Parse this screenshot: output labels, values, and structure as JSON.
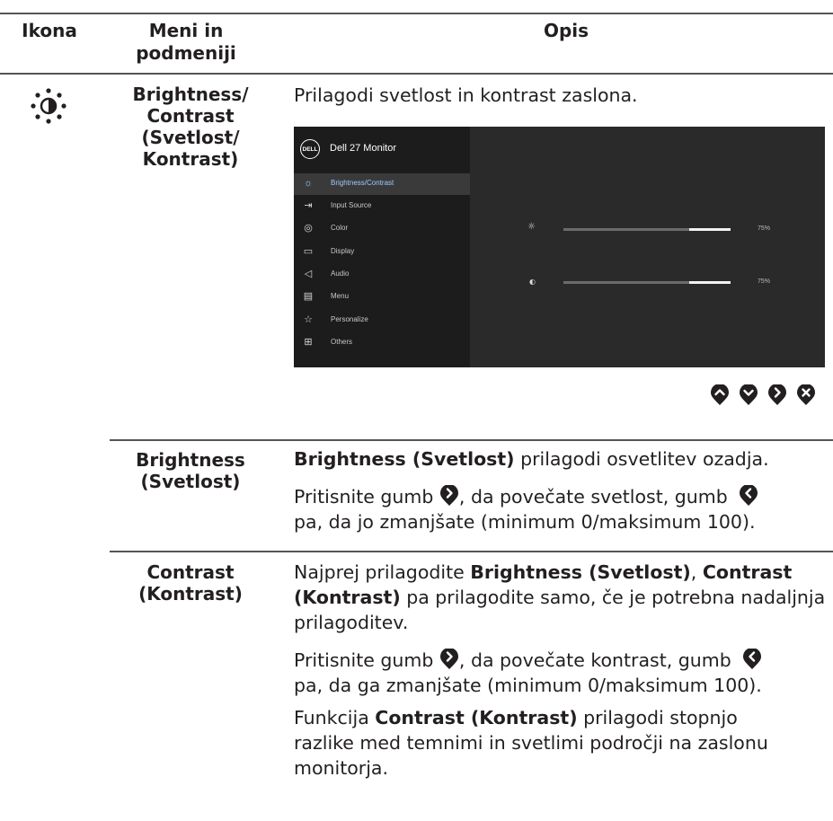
{
  "header": {
    "col_icon": "Ikona",
    "col_menu": "Meni in podmeniji",
    "col_desc": "Opis"
  },
  "row_main": {
    "icon": "brightness-icon",
    "menu_label": "Brightness/ Contrast (Svetlost/ Kontrast)",
    "menu_lines": [
      "Brightness/",
      "Contrast",
      "(Svetlost/",
      "Kontrast)"
    ],
    "description": "Prilagodi svetlost in kontrast zaslona."
  },
  "osd": {
    "title": "Dell 27 Monitor",
    "logo": "DELL",
    "menu_items": [
      {
        "label": "Brightness/Contrast",
        "icon": "sun-icon",
        "active": true
      },
      {
        "label": "Input Source",
        "icon": "input-icon",
        "active": false
      },
      {
        "label": "Color",
        "icon": "color-icon",
        "active": false
      },
      {
        "label": "Display",
        "icon": "display-icon",
        "active": false
      },
      {
        "label": "Audio",
        "icon": "audio-icon",
        "active": false
      },
      {
        "label": "Menu",
        "icon": "menu-icon",
        "active": false
      },
      {
        "label": "Personalize",
        "icon": "star-icon",
        "active": false
      },
      {
        "label": "Others",
        "icon": "others-icon",
        "active": false
      }
    ],
    "brightness": {
      "value": 75,
      "label": "75%"
    },
    "contrast": {
      "value": 75,
      "label": "75%"
    }
  },
  "nav_buttons": [
    "up-button",
    "down-button",
    "right-button",
    "close-button"
  ],
  "row_brightness": {
    "menu_lines": [
      "Brightness",
      "(Svetlost)"
    ],
    "p1_bold": "Brightness (Svetlost)",
    "p1_rest": " prilagodi osvetlitev ozadja.",
    "p2_a": "Pritisnite gumb ",
    "p2_b": ", da povečate svetlost, gumb ",
    "p2_c": "pa, da jo zmanjšate (minimum 0/maksimum 100)."
  },
  "row_contrast": {
    "menu_lines": [
      "Contrast",
      "(Kontrast)"
    ],
    "p1_a": "Najprej prilagodite ",
    "p1_b1": "Brightness (Svetlost)",
    "p1_c": ", ",
    "p1_b2": "Contrast (Kontrast)",
    "p1_d": " pa prilagodite samo, če je potrebna nadaljnja prilagoditev.",
    "p2_a": "Pritisnite gumb ",
    "p2_b": ", da povečate kontrast, gumb ",
    "p2_c": "pa, da ga zmanjšate (minimum 0/maksimum 100).",
    "p3_a": "Funkcija ",
    "p3_b": "Contrast (Kontrast)",
    "p3_c": " prilagodi stopnjo razlike med temnimi in svetlimi področji na zaslonu monitorja."
  },
  "colors": {
    "text": "#231f20",
    "osd_bg": "#1c1c1c",
    "osd_accent": "#9ec9ff",
    "button": "#231f20"
  }
}
